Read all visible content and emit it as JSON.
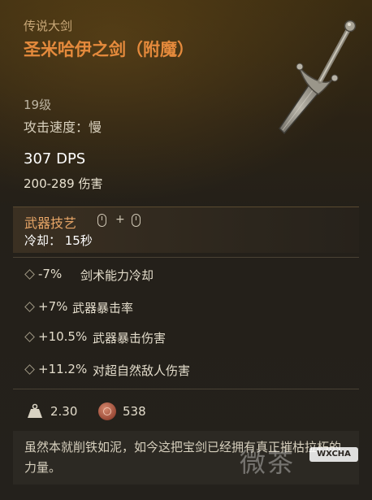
{
  "item": {
    "type": "传说大剑",
    "name": "圣米哈伊之剑（附魔）",
    "level": "19级",
    "attack_speed": "攻击速度：慢",
    "dps": "307 DPS",
    "damage": "200-289 伤害"
  },
  "skill": {
    "title": "武器技艺",
    "plus": "+",
    "cooldown": "冷却： 15秒"
  },
  "perks": [
    {
      "value": "-7%",
      "desc": "剑术能力冷却"
    },
    {
      "value": "+7%",
      "desc": "武器暴击率"
    },
    {
      "value": "+10.5%",
      "desc": "武器暴击伤害"
    },
    {
      "value": "+11.2%",
      "desc": "对超自然敌人伤害"
    }
  ],
  "stats": {
    "weight": "2.30",
    "sell_value": "538"
  },
  "flavor_text": "虽然本就削铁如泥，如今这把宝剑已经拥有真正摧枯拉朽的力量。",
  "watermark": {
    "chars": "微茶",
    "badge": "WXCHA"
  },
  "colors": {
    "name_legendary": "#e58a3c",
    "skill_title": "#e8a667",
    "type_label": "#c9a878"
  }
}
